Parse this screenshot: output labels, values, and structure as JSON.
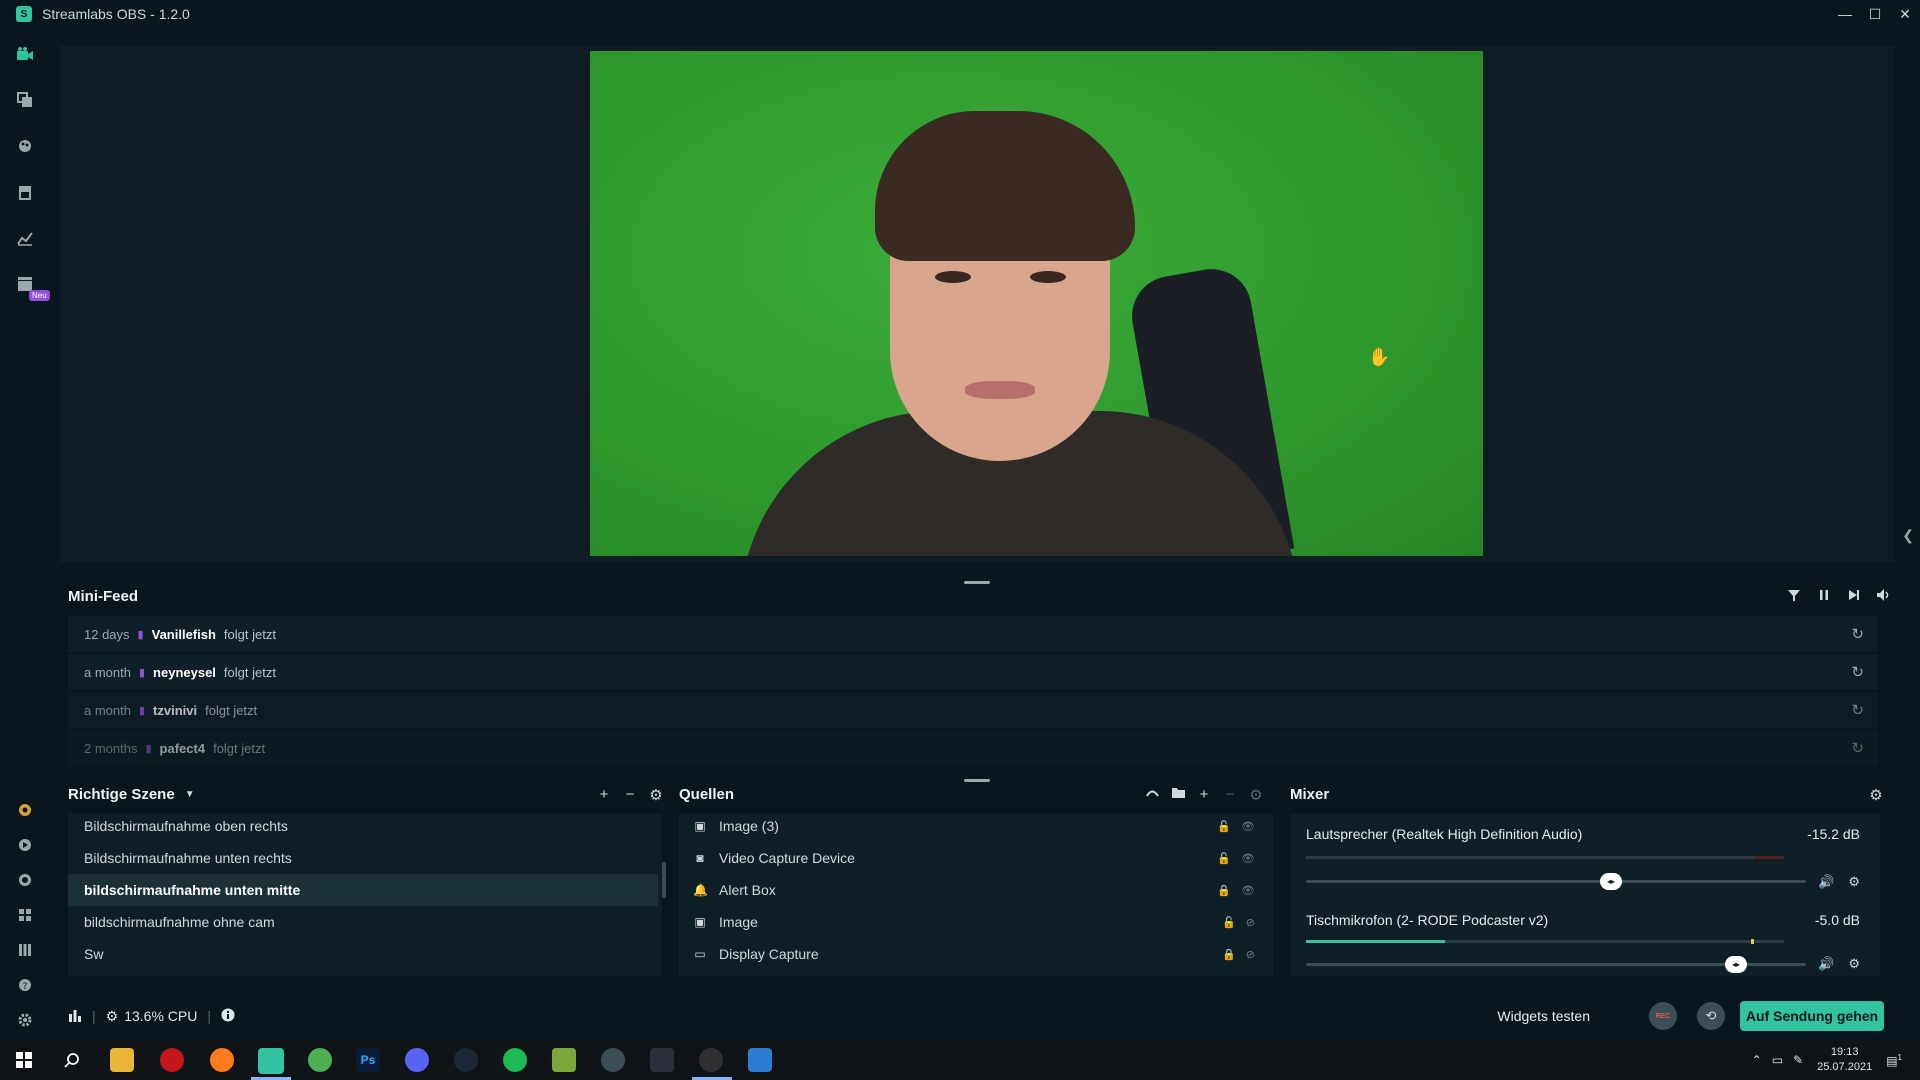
{
  "window": {
    "title": "Streamlabs OBS - 1.2.0",
    "logo_glyph": "S"
  },
  "window_controls": {
    "minimize": "—",
    "maximize": "☐",
    "close": "✕"
  },
  "leftnav": {
    "top_icons": [
      "editor-icon",
      "layout-icon",
      "themes-icon",
      "store-icon",
      "stats-icon",
      "highlighter-icon"
    ],
    "new_badge": "Neu",
    "bottom_icons": [
      "alert-icon",
      "play-icon",
      "chat-icon",
      "grid-icon",
      "columns-icon",
      "help-icon",
      "settings-icon"
    ]
  },
  "minifeed": {
    "title": "Mini-Feed",
    "rows": [
      {
        "time": "12 days",
        "user": "Vanillefish",
        "action": "folgt jetzt"
      },
      {
        "time": "a month",
        "user": "neyneysel",
        "action": "folgt jetzt"
      },
      {
        "time": "a month",
        "user": "tzvinivi",
        "action": "folgt jetzt"
      },
      {
        "time": "2 months",
        "user": "pafect4",
        "action": "folgt jetzt"
      }
    ]
  },
  "scenes": {
    "title": "Richtige Szene",
    "items": [
      "Bildschirmaufnahme oben rechts",
      "Bildschirmaufnahme unten rechts",
      "bildschirmaufnahme unten mitte",
      "bildschirmaufnahme ohne cam",
      "Sw"
    ],
    "selected_index": 2
  },
  "sources": {
    "title": "Quellen",
    "items": [
      {
        "name": "Image (3)",
        "icon": "image-icon"
      },
      {
        "name": "Video Capture Device",
        "icon": "camera-icon"
      },
      {
        "name": "Alert Box",
        "icon": "bell-icon"
      },
      {
        "name": "Image",
        "icon": "image-icon"
      },
      {
        "name": "Display Capture",
        "icon": "monitor-icon"
      }
    ]
  },
  "mixer": {
    "title": "Mixer",
    "channels": [
      {
        "name": "Lautsprecher (Realtek High Definition Audio)",
        "db": "-15.2 dB",
        "level": 0.0,
        "volume": 0.61
      },
      {
        "name": "Tischmikrofon (2- RODE Podcaster v2)",
        "db": "-5.0 dB",
        "level": 0.29,
        "volume": 0.86
      }
    ]
  },
  "statusbar": {
    "cpu": "13.6% CPU",
    "widgets_label": "Widgets testen",
    "rec_label": "REC",
    "golive_label": "Auf Sendung gehen"
  },
  "taskbar": {
    "clock_time": "19:13",
    "clock_date": "25.07.2021",
    "ps_label": "Ps",
    "notification_count": "1"
  },
  "colors": {
    "accent": "#31c3a2",
    "background": "#09161d",
    "panel": "#0f1f27",
    "twitch": "#8f4fd7"
  }
}
